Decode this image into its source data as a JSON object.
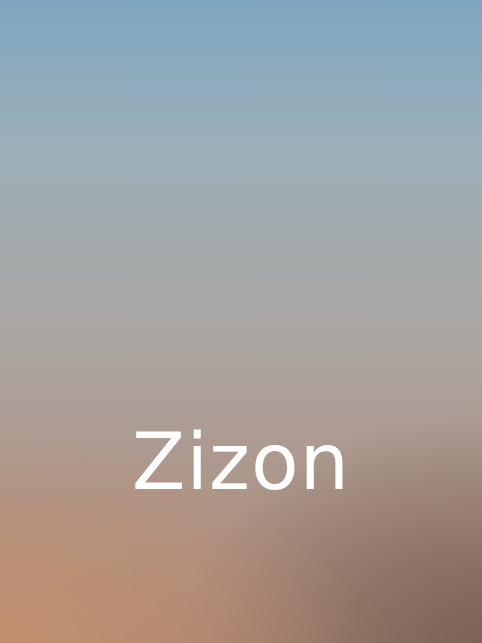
{
  "splash": {
    "app_name": "Zizon"
  },
  "colors": {
    "gradient_top": "#7ea6c0",
    "gradient_middle": "#aaa8a6",
    "gradient_bottom_left": "#c4906e",
    "gradient_bottom_right": "#786054",
    "title_text": "#ffffff"
  }
}
